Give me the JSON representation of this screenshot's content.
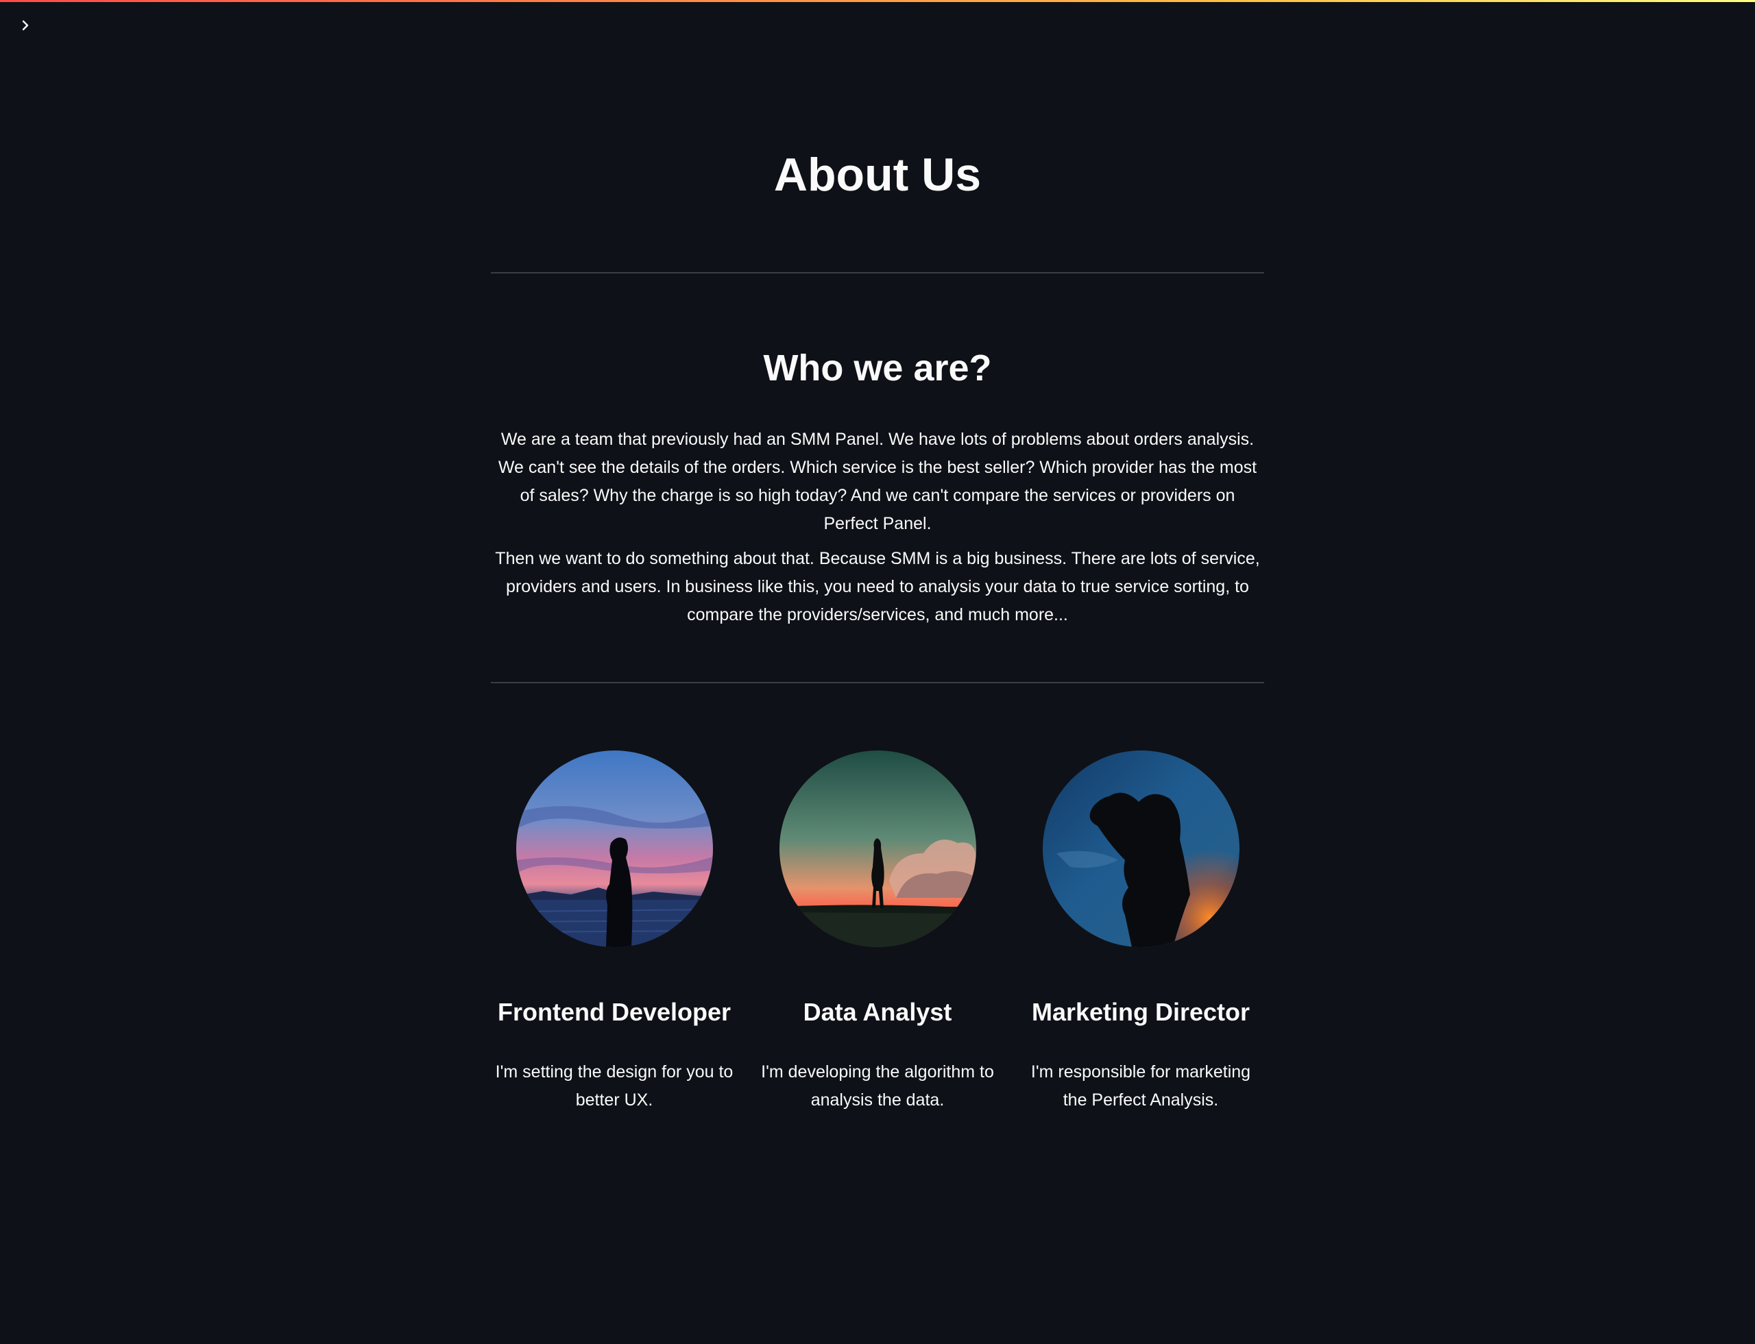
{
  "page": {
    "title": "About Us"
  },
  "about": {
    "heading": "Who we are?",
    "paragraphs": [
      "We are a team that previously had an SMM Panel. We have lots of problems about orders analysis. We can't see the details of the orders. Which service is the best seller? Which provider has the most of sales? Why the charge is so high today? And we can't compare the services or providers on Perfect Panel.",
      "Then we want to do something about that. Because SMM is a big business. There are lots of service, providers and users. In business like this, you need to analysis your data to true service sorting, to compare the providers/services, and much more..."
    ]
  },
  "team": [
    {
      "role": "Frontend Developer",
      "bio": "I'm setting the design for you to better UX."
    },
    {
      "role": "Data Analyst",
      "bio": "I'm developing the algorithm to analysis the data."
    },
    {
      "role": "Marketing Director",
      "bio": "I'm responsible for marketing the Perfect Analysis."
    }
  ],
  "icons": {
    "sidebar_toggle": "chevron-right-icon"
  },
  "colors": {
    "background": "#0e1117",
    "text": "#fafafa",
    "divider": "#3a3d45",
    "accent_gradient_start": "#ff4b4b",
    "accent_gradient_end": "#fffd80"
  }
}
